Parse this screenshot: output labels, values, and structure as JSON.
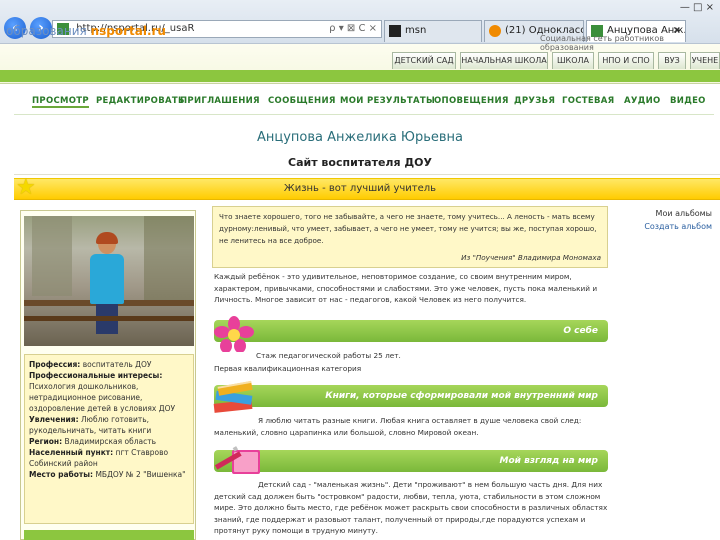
{
  "browser": {
    "address_url": "http://nsportal.ru/_usaR",
    "address_controls": "ρ ▾ ⊠ C ×",
    "tabs": [
      {
        "label": "msn"
      },
      {
        "label": "(21) Одноклассни..."
      },
      {
        "label": "Анцупова Анж..."
      }
    ],
    "window_controls": "— □ ×"
  },
  "site": {
    "logo_prefix": "образования",
    "logo_brand": "nsportal.ru",
    "slogan": "Социальная сеть работников образования",
    "section_tabs": [
      "ДЕТСКИЙ САД",
      "НАЧАЛЬНАЯ ШКОЛА",
      "ШКОЛА",
      "НПО И СПО",
      "ВУЗ",
      "УЧЕНЕ"
    ]
  },
  "nav": [
    "ПРОСМОТР",
    "РЕДАКТИРОВАТЬ",
    "ПРИГЛАШЕНИЯ",
    "СООБЩЕНИЯ",
    "МОИ РЕЗУЛЬТАТЫ",
    "ОПОВЕЩЕНИЯ",
    "ДРУЗЬЯ",
    "ГОСТЕВАЯ",
    "АУДИО",
    "ВИДЕО"
  ],
  "profile": {
    "name": "Анцупова Анжелика Юрьевна",
    "site_title": "Сайт воспитателя ДОУ",
    "motto": "Жизнь - вот лучший учитель"
  },
  "info": {
    "profession_label": "Профессия:",
    "profession": "воспитатель ДОУ",
    "interests_label": "Профессиональные интересы:",
    "interests": "Психология дошкольников, нетрадиционное рисование, оздоровление детей в условиях ДОУ",
    "hobbies_label": "Увлечения:",
    "hobbies": "Люблю готовить, рукодельничать, читать книги",
    "region_label": "Регион:",
    "region": "Владимирская область",
    "city_label": "Населенный пункт:",
    "city": "пгт Ставрово Собинский район",
    "work_label": "Место работы:",
    "work": "МБДОУ № 2 \"Вишенка\""
  },
  "quote": {
    "text": "Что знаете хорошего, того не забывайте, а чего не знаете, тому учитесь... А леность - мать всему дурному:ленивый, что умеет, забывает, а чего не умеет, тому не учится; вы же, поступая хорошо, не ленитесь на все доброе.",
    "author": "Из \"Поучения\" Владимира Мономаха"
  },
  "intro": "Каждый ребёнок - это удивительное, неповторимое создание, со своим внутренним миром, характером, привычками, способностями и слабостями. Это уже человек, пусть пока маленький и Личность. Многое зависит от нас - педагогов, какой Человек из него получится.",
  "sections": [
    {
      "title": "О себе"
    },
    {
      "title": "Книги, которые сформировали мой внутренний мир"
    },
    {
      "title": "Мой взгляд на мир"
    }
  ],
  "about": {
    "experience": "Стаж педагогической работы 25 лет.",
    "category": "Первая квалификационная категория"
  },
  "books_text": "Я люблю читать разные книги. Любая книга оставляет в душе человека свой след: маленький, словно царапинка или большой, словно Мировой океан.",
  "worldview_text": "Детский сад - \"маленькая жизнь\". Дети \"проживают\" в нем большую часть дня. Для них детский сад должен быть \"островком\" радости, любви, тепла, уюта, стабильности в этом сложном мире. Это должно быть место, где ребёнок может раскрыть свои способности в различных областях знаний, где поддержат и разовьют талант, полученный от природы,где порадуются успехам и протянут руку помощи в трудную минуту.",
  "right": {
    "albums": "Мои альбомы",
    "create_album": "Создать альбом"
  }
}
